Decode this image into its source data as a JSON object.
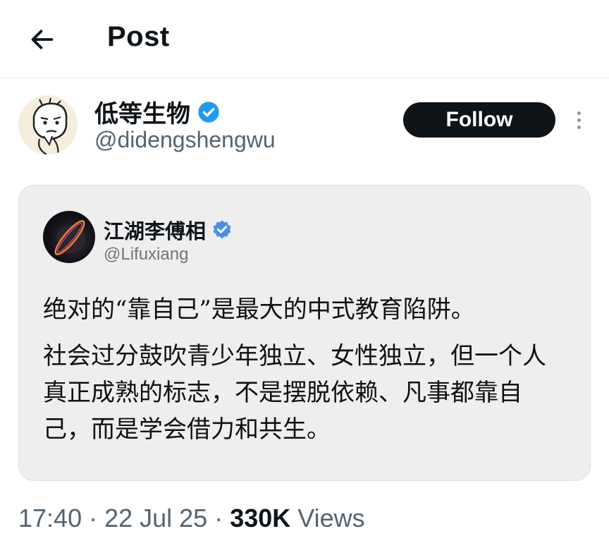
{
  "header": {
    "title": "Post",
    "back_icon": "arrow-left-icon"
  },
  "author": {
    "display_name": "低等生物",
    "handle": "@didengshengwu",
    "verified": true,
    "verified_color": "#1d9bf0",
    "follow_label": "Follow",
    "more_icon": "vertical-ellipsis-icon"
  },
  "quoted_post": {
    "display_name": "江湖李傅相",
    "handle": "@Lifuxiang",
    "verified": true,
    "verified_color": "#4a90e2",
    "paragraphs": [
      "绝对的“靠自己”是最大的中式教育陷阱。",
      "社会过分鼓吹青少年独立、女性独立，但一个人真正成熟的标志，不是摆脱依赖、凡事都靠自己，而是学会借力和共生。"
    ]
  },
  "meta": {
    "time": "17:40",
    "separator": " · ",
    "date": "22 Jul 25",
    "views_count": "330K",
    "views_label": " Views"
  }
}
